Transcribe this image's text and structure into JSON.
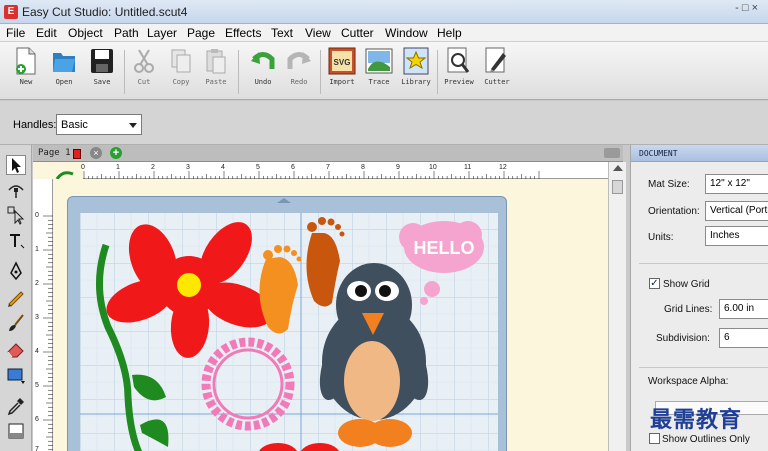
{
  "window": {
    "title": "Easy Cut Studio: Untitled.scut4",
    "title_right": "- □ ×"
  },
  "menu": [
    "File",
    "Edit",
    "Object",
    "Path",
    "Layer",
    "Page",
    "Effects",
    "Text",
    "View",
    "Cutter",
    "Window",
    "Help"
  ],
  "toolbar": {
    "new": "New",
    "open": "Open",
    "save": "Save",
    "cut": "Cut",
    "copy": "Copy",
    "paste": "Paste",
    "undo": "Undo",
    "redo": "Redo",
    "import": "Import",
    "import_badge": "SVG",
    "trace": "Trace",
    "library": "Library",
    "preview": "Preview",
    "cutter": "Cutter"
  },
  "properties_bar": {
    "handles_label": "Handles:",
    "handles_value": "Basic"
  },
  "page_tab": {
    "label": "Page 1",
    "close_glyph": "×",
    "add_glyph": "+"
  },
  "ruler": {
    "h": [
      "0",
      "1",
      "2",
      "3",
      "4",
      "5",
      "6",
      "7",
      "8",
      "9",
      "10",
      "11",
      "12"
    ],
    "v": [
      "0",
      "1",
      "2",
      "3",
      "4",
      "5",
      "6",
      "7"
    ]
  },
  "artwork": {
    "speech_bubble_text": "HELLO"
  },
  "document_panel": {
    "title": "DOCUMENT",
    "mat_size_label": "Mat Size:",
    "mat_size_value": "12\" x 12\"",
    "orientation_label": "Orientation:",
    "orientation_value": "Vertical (Portrait)",
    "units_label": "Units:",
    "units_value": "Inches",
    "show_grid_label": "Show Grid",
    "show_grid_checked": true,
    "grid_lines_label": "Grid Lines:",
    "grid_lines_value": "6.00 in",
    "subdivision_label": "Subdivision:",
    "subdivision_value": "6",
    "workspace_alpha_label": "Workspace Alpha:",
    "show_outlines_label": "Show Outlines Only",
    "show_outlines_checked": false
  },
  "watermark": "最需教育",
  "colors": {
    "flower_red": "#f01818",
    "flower_center": "#ffe800",
    "stem_green": "#1f8a1f",
    "foot_orange": "#f39020",
    "foot_brown": "#c8560c",
    "penguin_body": "#3f4f5e",
    "penguin_belly": "#f0b884",
    "bubble_pink": "#f5a4d0",
    "wreath_pink": "#f27ab8"
  }
}
